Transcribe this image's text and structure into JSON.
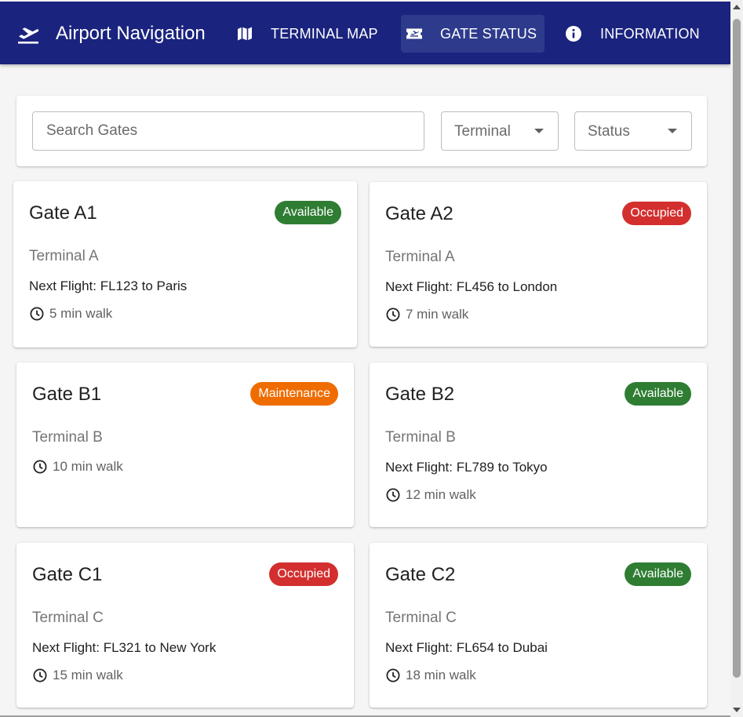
{
  "app": {
    "title": "Airport Navigation",
    "brand_icon": "flight-takeoff-icon",
    "colors": {
      "appbar": "#1a237e",
      "available": "#2e7d32",
      "occupied": "#d32f2f",
      "maintenance": "#ef6c00"
    }
  },
  "nav": {
    "terminal_map": {
      "label": "TERMINAL MAP",
      "icon": "map-icon"
    },
    "gate_status": {
      "label": "GATE STATUS",
      "icon": "airplane-ticket-icon",
      "active": true
    },
    "information": {
      "label": "INFORMATION",
      "icon": "info-icon"
    }
  },
  "filters": {
    "search_placeholder": "Search Gates",
    "search_value": "",
    "terminal_label": "Terminal",
    "status_label": "Status"
  },
  "gates": [
    {
      "name": "Gate A1",
      "status": "Available",
      "terminal": "Terminal A",
      "next_flight": "Next Flight: FL123 to Paris",
      "walk": "5 min walk"
    },
    {
      "name": "Gate A2",
      "status": "Occupied",
      "terminal": "Terminal A",
      "next_flight": "Next Flight: FL456 to London",
      "walk": "7 min walk"
    },
    {
      "name": "Gate B1",
      "status": "Maintenance",
      "terminal": "Terminal B",
      "next_flight": "",
      "walk": "10 min walk"
    },
    {
      "name": "Gate B2",
      "status": "Available",
      "terminal": "Terminal B",
      "next_flight": "Next Flight: FL789 to Tokyo",
      "walk": "12 min walk"
    },
    {
      "name": "Gate C1",
      "status": "Occupied",
      "terminal": "Terminal C",
      "next_flight": "Next Flight: FL321 to New York",
      "walk": "15 min walk"
    },
    {
      "name": "Gate C2",
      "status": "Available",
      "terminal": "Terminal C",
      "next_flight": "Next Flight: FL654 to Dubai",
      "walk": "18 min walk"
    }
  ]
}
